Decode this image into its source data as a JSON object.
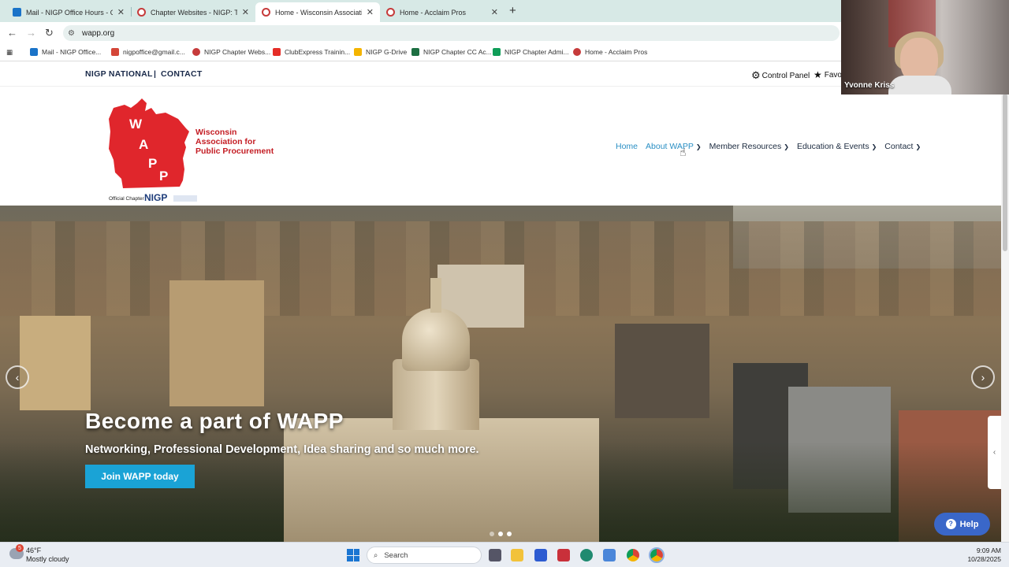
{
  "browser": {
    "tabs": [
      {
        "title": "Mail - NIGP Office Hours - Outl",
        "icon": "outlook-icon",
        "active": false
      },
      {
        "title": "Chapter Websites - NIGP: The I",
        "icon": "nigp-icon",
        "active": false
      },
      {
        "title": "Home - Wisconsin Association",
        "icon": "nigp-icon",
        "active": true
      },
      {
        "title": "Home - Acclaim Pros",
        "icon": "nigp-icon",
        "active": false
      }
    ],
    "new_tab_label": "+",
    "url": "wapp.org",
    "bookmarks": [
      {
        "label": "Mail - NIGP Office...",
        "icon": "outlook-icon",
        "color": "#1a73c8"
      },
      {
        "label": "nigpoffice@gmail.c...",
        "icon": "gmail-icon",
        "color": "#d44638"
      },
      {
        "label": "NIGP Chapter Webs...",
        "icon": "nigp-icon",
        "color": "#c63b3b"
      },
      {
        "label": "ClubExpress Trainin...",
        "icon": "youtube-icon",
        "color": "#e52d27"
      },
      {
        "label": "NIGP G-Drive",
        "icon": "drive-icon",
        "color": "#f4b400"
      },
      {
        "label": "NIGP Chapter CC Ac...",
        "icon": "excel-icon",
        "color": "#1d6f42"
      },
      {
        "label": "NIGP Chapter Admi...",
        "icon": "sheets-icon",
        "color": "#0f9d58"
      },
      {
        "label": "Home - Acclaim Pros",
        "icon": "nigp-icon",
        "color": "#c63b3b"
      }
    ]
  },
  "site": {
    "top_links": {
      "national": "NIGP NATIONAL",
      "separator": "|",
      "contact": "CONTACT"
    },
    "control_panel": "Control Panel",
    "favorites": "Favo",
    "logo": {
      "letters": [
        "W",
        "A",
        "P",
        "P"
      ],
      "name_line1": "Wisconsin",
      "name_line2": "Association for",
      "name_line3": "Public Procurement",
      "chapter_text": "Official Chapter",
      "nigp_text": "NIGP",
      "brand_red": "#e0262c"
    },
    "nav": [
      {
        "label": "Home",
        "dropdown": false,
        "active": true
      },
      {
        "label": "About WAPP",
        "dropdown": true,
        "active": true
      },
      {
        "label": "Member Resources",
        "dropdown": true,
        "active": false
      },
      {
        "label": "Education & Events",
        "dropdown": true,
        "active": false
      },
      {
        "label": "Contact",
        "dropdown": true,
        "active": false
      }
    ],
    "hero": {
      "title": "Become a part of WAPP",
      "subtitle": "Networking, Professional Development, Idea sharing and so much more.",
      "cta": "Join WAPP today",
      "prev": "‹",
      "next": "›",
      "slide_count": 3,
      "active_slide": 2
    },
    "help": "Help",
    "side_tab": "‹"
  },
  "webcam": {
    "name": "Yvonne Kriss"
  },
  "taskbar": {
    "weather_temp": "46°F",
    "weather_desc": "Mostly cloudy",
    "weather_badge": "5",
    "search": "Search",
    "time": "9:09 AM",
    "date": "10/28/2025"
  },
  "colors": {
    "accent": "#1aa3d6",
    "nav_active": "#2a8fc4",
    "help": "#3a67c9"
  }
}
